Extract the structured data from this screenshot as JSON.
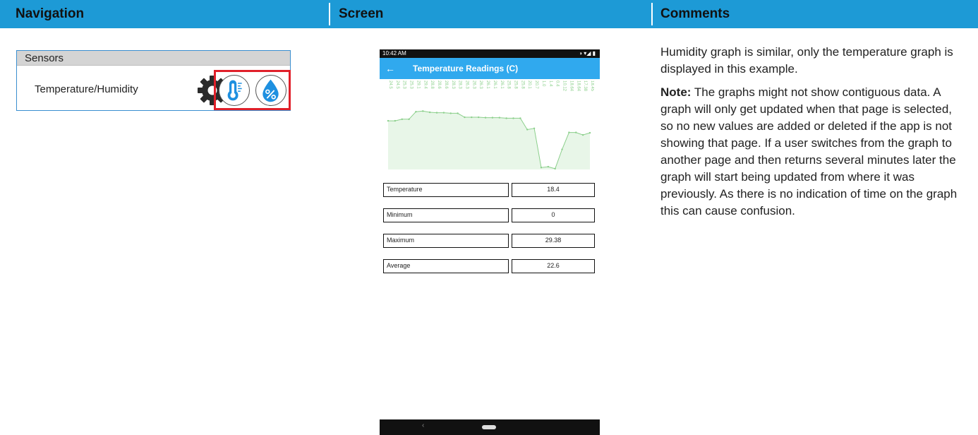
{
  "header": {
    "col1": "Navigation",
    "col2": "Screen",
    "col3": "Comments"
  },
  "navigation": {
    "section_title": "Sensors",
    "item_label": "Temperature/Humidity",
    "icons": [
      "gear-icon",
      "thermometer-icon",
      "humidity-percent-icon"
    ],
    "highlight_color": "#e0202a"
  },
  "screen": {
    "status_time": "10:42 AM",
    "status_icons": "◑ ▾◢ ▮",
    "app_title": "Temperature Readings (C)",
    "back_arrow": "←",
    "nav_back": "‹",
    "rows": [
      {
        "label": "Temperature",
        "value": "18.4"
      },
      {
        "label": "Minimum",
        "value": "0"
      },
      {
        "label": "Maximum",
        "value": "29.38"
      },
      {
        "label": "Average",
        "value": "22.6"
      }
    ]
  },
  "chart_data": {
    "type": "area",
    "labels": [
      "24.5",
      "24.5",
      "25.3",
      "25.3",
      "29.1",
      "29.4",
      "28.8",
      "28.6",
      "28.6",
      "28.3",
      "28.3",
      "26.3",
      "26.3",
      "26.3",
      "26.1",
      "26.1",
      "26.1",
      "25.8",
      "25.8",
      "25.8",
      "20.1",
      "20.7",
      "1.0",
      "1.4",
      "0.4",
      "10.12",
      "18.64",
      "18.64",
      "17.38",
      "18.45"
    ],
    "values": [
      24.5,
      24.5,
      25.3,
      25.3,
      29.1,
      29.4,
      28.8,
      28.6,
      28.6,
      28.3,
      28.3,
      26.3,
      26.3,
      26.3,
      26.1,
      26.1,
      26.1,
      25.8,
      25.8,
      25.8,
      20.1,
      20.7,
      1.0,
      1.4,
      0.4,
      10.12,
      18.64,
      18.64,
      17.38,
      18.45
    ],
    "ylim": [
      0,
      32
    ],
    "line_color": "#8bcf8b",
    "fill_color": "#e8f6e8",
    "label_color": "#8bd08b"
  },
  "comments": {
    "p1": "Humidity graph is similar, only the temperature graph is displayed in this example.",
    "note_label": "Note:",
    "note_text": " The graphs might not show contiguous data. A graph will only get updated when that page is selected, so no new values are added or deleted if the app is not showing that page. If a user switches from the graph to another page and then returns several minutes later the graph will start being updated from where it was previously. As there is no indication of time on the graph this can cause confusion."
  }
}
